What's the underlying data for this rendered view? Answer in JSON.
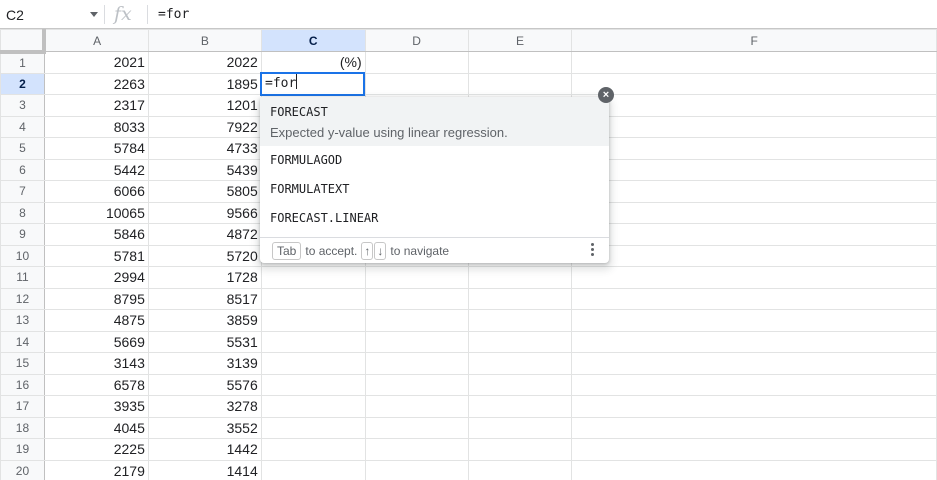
{
  "formula_bar": {
    "name_box": "C2",
    "fx_label": "fx",
    "formula": "=for"
  },
  "columns": [
    "A",
    "B",
    "C",
    "D",
    "E",
    "F"
  ],
  "selected_column": "C",
  "selected_row": 2,
  "rows": [
    {
      "n": "1",
      "a": "2021",
      "b": "2022",
      "c": "(%)"
    },
    {
      "n": "2",
      "a": "2263",
      "b": "1895",
      "c": ""
    },
    {
      "n": "3",
      "a": "2317",
      "b": "1201",
      "c": ""
    },
    {
      "n": "4",
      "a": "8033",
      "b": "7922",
      "c": ""
    },
    {
      "n": "5",
      "a": "5784",
      "b": "4733",
      "c": ""
    },
    {
      "n": "6",
      "a": "5442",
      "b": "5439",
      "c": ""
    },
    {
      "n": "7",
      "a": "6066",
      "b": "5805",
      "c": ""
    },
    {
      "n": "8",
      "a": "10065",
      "b": "9566",
      "c": ""
    },
    {
      "n": "9",
      "a": "5846",
      "b": "4872",
      "c": ""
    },
    {
      "n": "10",
      "a": "5781",
      "b": "5720",
      "c": ""
    },
    {
      "n": "11",
      "a": "2994",
      "b": "1728",
      "c": ""
    },
    {
      "n": "12",
      "a": "8795",
      "b": "8517",
      "c": ""
    },
    {
      "n": "13",
      "a": "4875",
      "b": "3859",
      "c": ""
    },
    {
      "n": "14",
      "a": "5669",
      "b": "5531",
      "c": ""
    },
    {
      "n": "15",
      "a": "3143",
      "b": "3139",
      "c": ""
    },
    {
      "n": "16",
      "a": "6578",
      "b": "5576",
      "c": ""
    },
    {
      "n": "17",
      "a": "3935",
      "b": "3278",
      "c": ""
    },
    {
      "n": "18",
      "a": "4045",
      "b": "3552",
      "c": ""
    },
    {
      "n": "19",
      "a": "2225",
      "b": "1442",
      "c": ""
    },
    {
      "n": "20",
      "a": "2179",
      "b": "1414",
      "c": ""
    }
  ],
  "editor": {
    "value": "=for"
  },
  "autocomplete": {
    "suggestions": [
      {
        "name": "FORECAST",
        "description": "Expected y-value using linear regression."
      },
      {
        "name": "FORMULAGOD",
        "description": ""
      },
      {
        "name": "FORMULATEXT",
        "description": ""
      },
      {
        "name": "FORECAST.LINEAR",
        "description": ""
      }
    ],
    "footer": {
      "tab_key": "Tab",
      "accept_text": "to accept.",
      "up_key": "↑",
      "down_key": "↓",
      "navigate_text": "to navigate"
    },
    "close_icon": "×"
  }
}
